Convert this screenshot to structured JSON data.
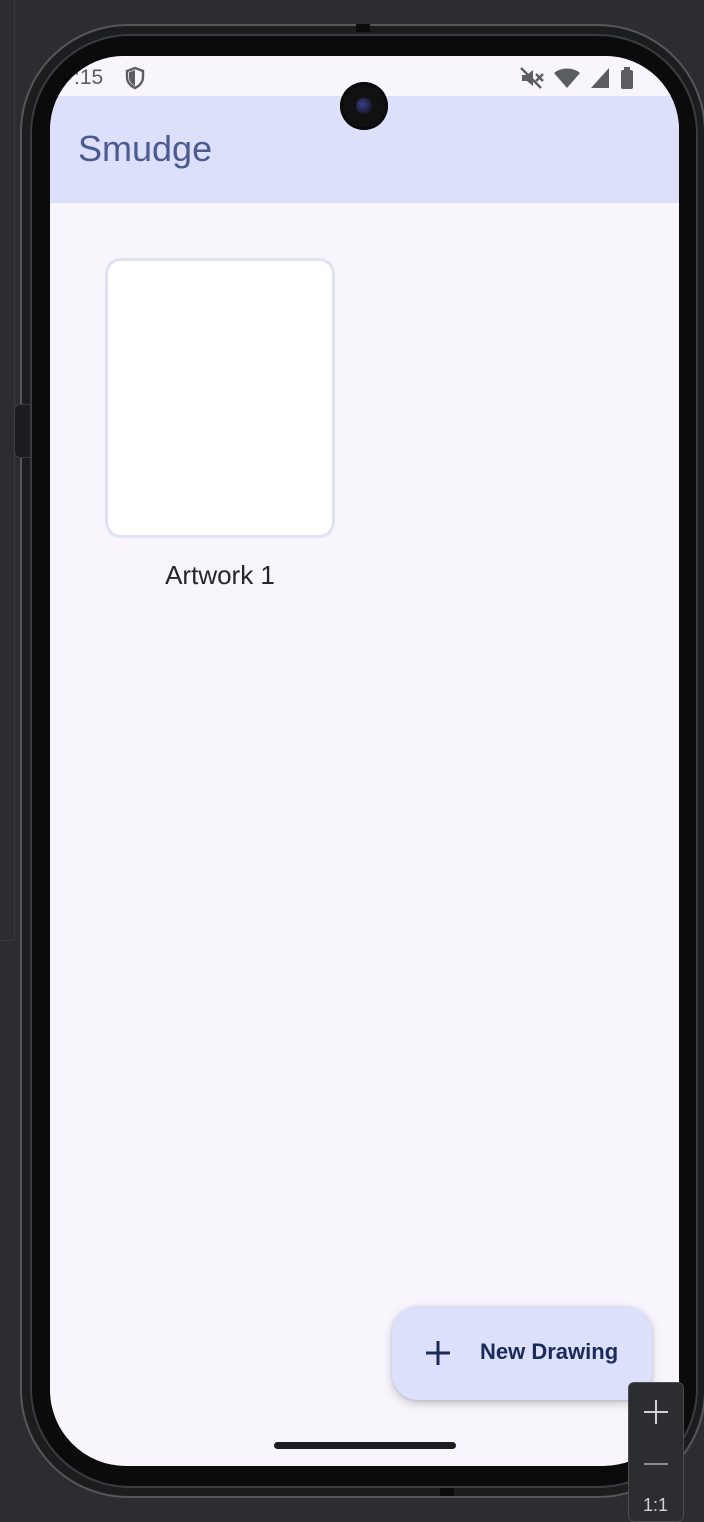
{
  "status_bar": {
    "time": ":15",
    "icons": [
      "shield-icon",
      "mute-icon",
      "wifi-icon",
      "signal-icon",
      "battery-icon"
    ]
  },
  "app_bar": {
    "title": "Smudge"
  },
  "artworks": [
    {
      "name": "Artwork 1"
    }
  ],
  "fab": {
    "label": "New Drawing",
    "icon": "plus-icon"
  },
  "emulator_zoom": {
    "zoom_in_icon": "plus-icon",
    "zoom_out_icon": "minus-icon",
    "reset_label": "1:1"
  },
  "colors": {
    "app_bar_bg": "#dce0fb",
    "title_color": "#4c5b8f",
    "screen_bg": "#f8f5fd",
    "fab_bg": "#dce0fb",
    "fab_text": "#1c2a5a"
  }
}
